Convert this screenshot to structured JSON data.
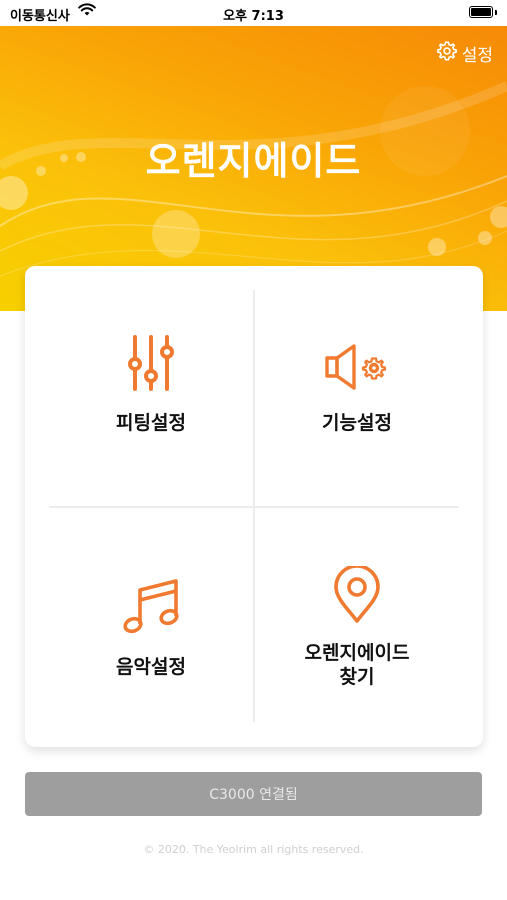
{
  "status_bar": {
    "carrier": "이동통신사",
    "time": "오후 7:13"
  },
  "header": {
    "settings_label": "설정",
    "title": "오렌지에이드"
  },
  "menu": [
    {
      "label": "피팅설정",
      "icon": "equalizer-sliders-icon"
    },
    {
      "label": "기능설정",
      "icon": "speaker-gear-icon"
    },
    {
      "label": "음악설정",
      "icon": "music-note-icon"
    },
    {
      "label_line1": "오렌지에이드",
      "label_line2": "찾기",
      "icon": "location-pin-icon"
    }
  ],
  "connect_button": {
    "label": "C3000 연결됨"
  },
  "footer": {
    "copyright": "© 2020. The Yeolrim all rights reserved."
  },
  "colors": {
    "accent_orange": "#f07a30",
    "hero_orange": "#f68a07",
    "hero_yellow": "#f7d000",
    "button_gray": "#9e9e9e"
  }
}
